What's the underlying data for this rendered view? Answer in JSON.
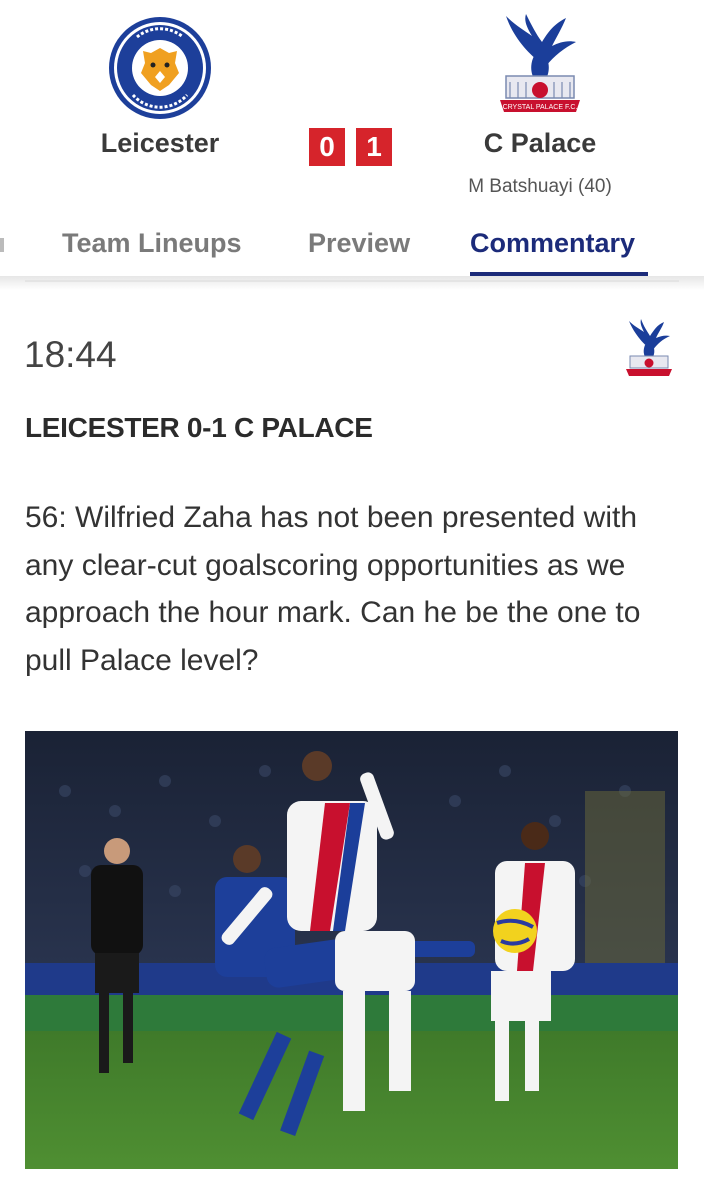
{
  "match": {
    "home": {
      "name": "Leicester",
      "score": "0",
      "crest": "leicester-city-fc-crest"
    },
    "away": {
      "name": "C Palace",
      "score": "1",
      "crest": "crystal-palace-fc-crest",
      "scorers": "M Batshuayi (40)"
    }
  },
  "tabs": [
    {
      "label": "Team Lineups"
    },
    {
      "label": "Preview"
    },
    {
      "label": "Commentary",
      "active": true
    }
  ],
  "entry": {
    "time": "18:44",
    "headline": "LEICESTER 0-1 C PALACE",
    "text": "56: Wilfried Zaha has not been presented with any clear-cut goalscoring opportunities as we approach the hour mark. Can he be the one to pull Palace level?",
    "team_badge": "crystal-palace-fc-crest",
    "photo": "match-action-photo"
  },
  "colors": {
    "accent": "#1c2b7a",
    "score_bg": "#d6242b",
    "leicester_blue": "#1d3f9a",
    "palace_red": "#c8102e"
  }
}
